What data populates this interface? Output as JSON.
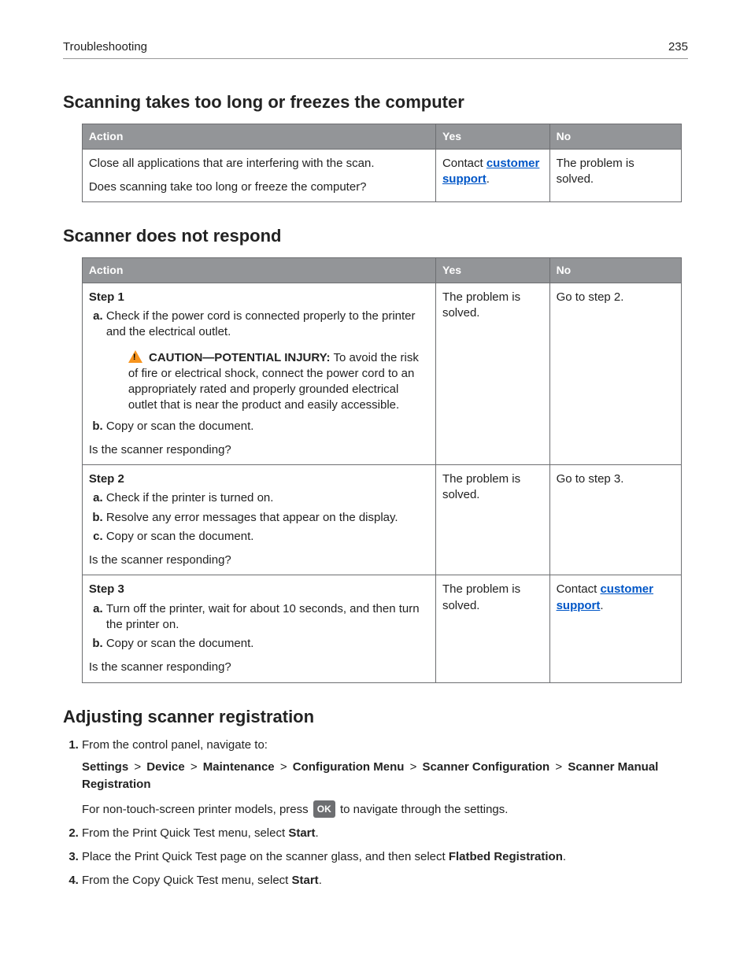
{
  "header": {
    "section": "Troubleshooting",
    "page": "235"
  },
  "sec1": {
    "title": "Scanning takes too long or freezes the computer",
    "cols": {
      "action": "Action",
      "yes": "Yes",
      "no": "No"
    },
    "row": {
      "line1": "Close all applications that are interfering with the scan.",
      "question": "Does scanning take too long or freeze the computer?",
      "yes_pre": "Contact ",
      "yes_link": "customer support",
      "yes_post": ".",
      "no": "The problem is solved."
    }
  },
  "sec2": {
    "title": "Scanner does not respond",
    "cols": {
      "action": "Action",
      "yes": "Yes",
      "no": "No"
    },
    "solved": "The problem is solved.",
    "s1": {
      "label": "Step 1",
      "a": "Check if the power cord is connected properly to the printer and the electrical outlet.",
      "caution_label": "CAUTION—POTENTIAL INJURY:",
      "caution_text": " To avoid the risk of fire or electrical shock, connect the power cord to an appropriately rated and properly grounded electrical outlet that is near the product and easily accessible.",
      "b": "Copy or scan the document.",
      "question": "Is the scanner responding?",
      "no": "Go to step 2."
    },
    "s2": {
      "label": "Step 2",
      "a": "Check if the printer is turned on.",
      "b": "Resolve any error messages that appear on the display.",
      "c": "Copy or scan the document.",
      "question": "Is the scanner responding?",
      "no": "Go to step 3."
    },
    "s3": {
      "label": "Step 3",
      "a": "Turn off the printer, wait for about 10 seconds, and then turn the printer on.",
      "b": "Copy or scan the document.",
      "question": "Is the scanner responding?",
      "no_pre": "Contact ",
      "no_link": "customer support",
      "no_post": "."
    }
  },
  "sec3": {
    "title": "Adjusting scanner registration",
    "step1_intro": "From the control panel, navigate to:",
    "path": [
      "Settings",
      "Device",
      "Maintenance",
      "Configuration Menu",
      "Scanner Configuration",
      "Scanner Manual Registration"
    ],
    "sep": ">",
    "non_touch_pre": "For non-touch-screen printer models, press ",
    "ok": "OK",
    "non_touch_post": " to navigate through the settings.",
    "step2_pre": "From the Print Quick Test menu, select ",
    "step2_bold": "Start",
    "step2_post": ".",
    "step3_pre": "Place the Print Quick Test page on the scanner glass, and then select ",
    "step3_bold": "Flatbed Registration",
    "step3_post": ".",
    "step4_pre": "From the Copy Quick Test menu, select ",
    "step4_bold": "Start",
    "step4_post": "."
  }
}
